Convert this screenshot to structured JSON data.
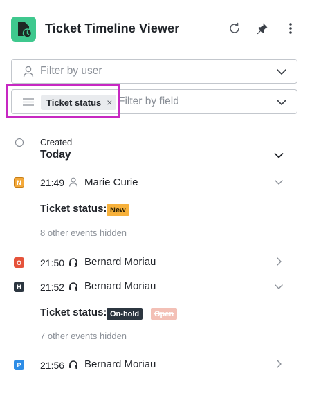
{
  "header": {
    "title": "Ticket Timeline Viewer",
    "icons": [
      "app-logo",
      "refresh-icon",
      "pin-icon",
      "more-vertical-icon"
    ]
  },
  "filters": {
    "user_placeholder": "Filter by user",
    "field_placeholder": "Filter by field",
    "field_chip": "Ticket status",
    "chip_remove": "×"
  },
  "timeline": {
    "created_label": "Created",
    "group_label": "Today",
    "events": [
      {
        "badge": "N",
        "time": "21:49",
        "user": "Marie Curie",
        "user_icon": "person-icon",
        "expanded": true,
        "status_label": "Ticket status:",
        "status_new": "New",
        "hidden_note": "8 other events hidden"
      },
      {
        "badge": "O",
        "time": "21:50",
        "user": "Bernard Moriau",
        "user_icon": "headset-icon",
        "expanded": false
      },
      {
        "badge": "H",
        "time": "21:52",
        "user": "Bernard Moriau",
        "user_icon": "headset-icon",
        "expanded": true,
        "status_label": "Ticket status:",
        "status_new": "On-hold",
        "status_old": "Open",
        "hidden_note": "7 other events hidden"
      },
      {
        "badge": "P",
        "time": "21:56",
        "user": "Bernard Moriau",
        "user_icon": "headset-icon",
        "expanded": false
      }
    ]
  },
  "colors": {
    "accent": "#3fc88e",
    "highlight": "#c728c2",
    "new": "#f7b13b",
    "open": "#e5533b",
    "onhold": "#2c3640",
    "pending": "#2e8de6"
  }
}
